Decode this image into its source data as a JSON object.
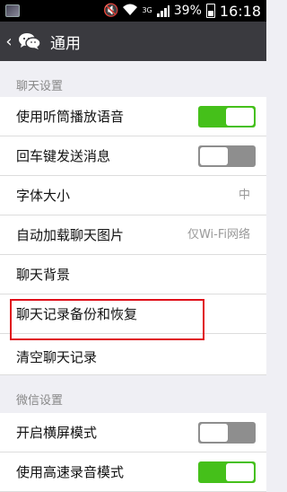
{
  "status_bar": {
    "network": "3G",
    "battery": "39%",
    "time": "16:18"
  },
  "nav": {
    "back_icon": "chevron-left-icon",
    "app_icon": "wechat-icon",
    "title": "通用"
  },
  "sections": {
    "chat": "聊天设置",
    "wechat": "微信设置"
  },
  "rows": {
    "earpiece": {
      "label": "使用听筒播放语音",
      "toggle": "on"
    },
    "enter_send": {
      "label": "回车键发送消息",
      "toggle": "off"
    },
    "font_size": {
      "label": "字体大小",
      "value": "中"
    },
    "auto_download": {
      "label": "自动加载聊天图片",
      "value": "仅Wi-Fi网络"
    },
    "background": {
      "label": "聊天背景"
    },
    "backup": {
      "label": "聊天记录备份和恢复"
    },
    "clear": {
      "label": "清空聊天记录"
    },
    "landscape": {
      "label": "开启横屏模式",
      "toggle": "off"
    },
    "hq_record": {
      "label": "使用高速录音模式",
      "toggle": "on"
    }
  },
  "colors": {
    "nav_bg": "#3a3a3f",
    "toggle_on": "#45c01a",
    "highlight": "#e0101a"
  }
}
